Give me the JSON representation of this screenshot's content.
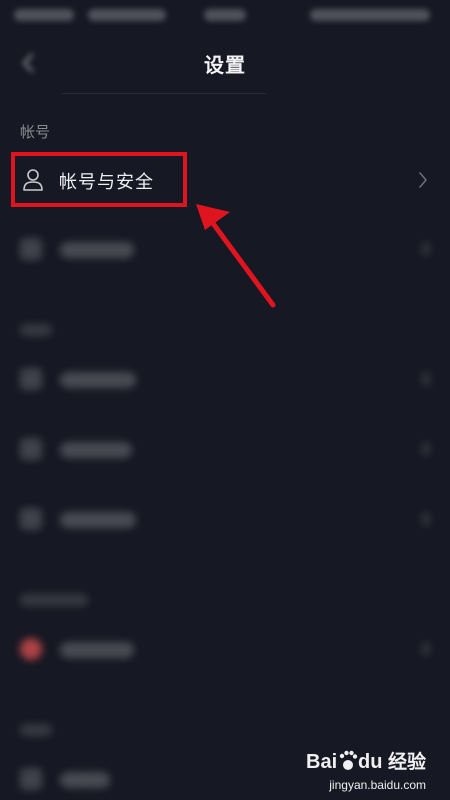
{
  "header": {
    "title": "设置"
  },
  "account_section": {
    "label": "帐号",
    "items": [
      {
        "label": "帐号与安全",
        "icon": "user-icon"
      }
    ]
  },
  "annotation": {
    "color": "#e0141e"
  },
  "watermark": {
    "text": "经验",
    "domain": "jingyan.baidu.com",
    "logo_text": "Bai du"
  }
}
